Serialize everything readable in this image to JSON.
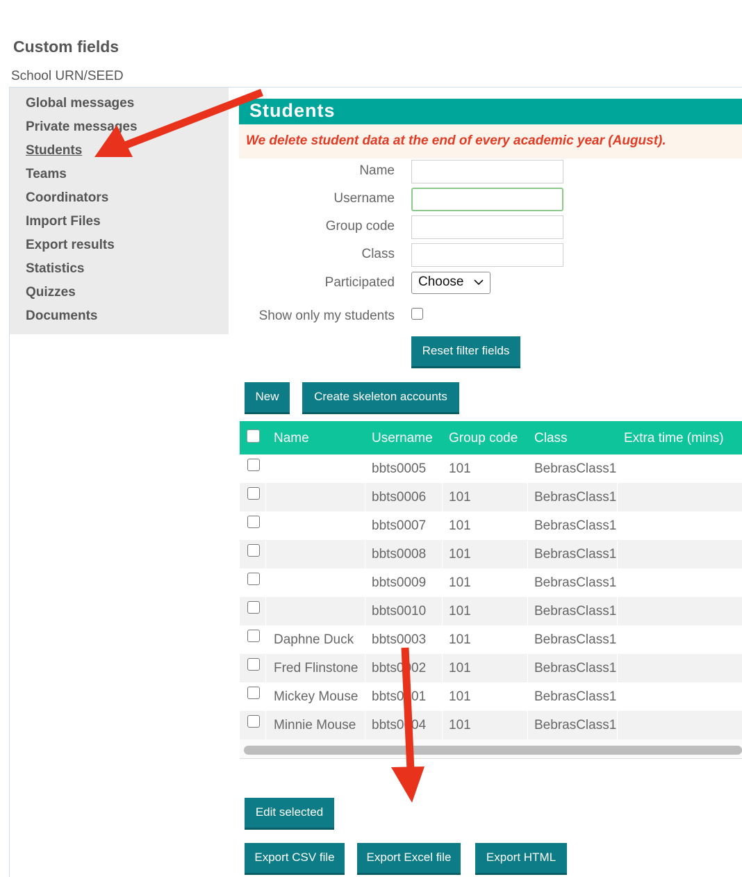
{
  "page": {
    "custom_fields_title": "Custom fields",
    "school_label": "School URN/SEED"
  },
  "sidebar": {
    "items": [
      {
        "label": "Global messages"
      },
      {
        "label": "Private messages"
      },
      {
        "label": "Students",
        "active": true
      },
      {
        "label": "Teams"
      },
      {
        "label": "Coordinators"
      },
      {
        "label": "Import Files"
      },
      {
        "label": "Export results"
      },
      {
        "label": "Statistics"
      },
      {
        "label": "Quizzes"
      },
      {
        "label": "Documents"
      }
    ]
  },
  "students": {
    "title": "Students",
    "notice": "We delete student data at the end of every academic year (August)."
  },
  "filters": {
    "name_label": "Name",
    "username_label": "Username",
    "group_code_label": "Group code",
    "class_label": "Class",
    "participated_label": "Participated",
    "participated_value": "Choose",
    "show_only_mine_label": "Show only my students",
    "name_value": "",
    "username_value": "",
    "group_code_value": "",
    "class_value": ""
  },
  "buttons": {
    "reset": "Reset filter fields",
    "new": "New",
    "skeleton": "Create skeleton accounts",
    "edit_selected": "Edit selected",
    "export_csv": "Export CSV file",
    "export_excel": "Export Excel file",
    "export_html": "Export HTML"
  },
  "table": {
    "headers": {
      "name": "Name",
      "username": "Username",
      "group_code": "Group code",
      "class": "Class",
      "extra_time": "Extra time (mins)"
    },
    "rows": [
      {
        "name": "",
        "username": "bbts0005",
        "group_code": "101",
        "class": "BebrasClass1"
      },
      {
        "name": "",
        "username": "bbts0006",
        "group_code": "101",
        "class": "BebrasClass1"
      },
      {
        "name": "",
        "username": "bbts0007",
        "group_code": "101",
        "class": "BebrasClass1"
      },
      {
        "name": "",
        "username": "bbts0008",
        "group_code": "101",
        "class": "BebrasClass1"
      },
      {
        "name": "",
        "username": "bbts0009",
        "group_code": "101",
        "class": "BebrasClass1"
      },
      {
        "name": "",
        "username": "bbts0010",
        "group_code": "101",
        "class": "BebrasClass1"
      },
      {
        "name": "Daphne Duck",
        "username": "bbts0003",
        "group_code": "101",
        "class": "BebrasClass1"
      },
      {
        "name": "Fred Flinstone",
        "username": "bbts0002",
        "group_code": "101",
        "class": "BebrasClass1"
      },
      {
        "name": "Mickey Mouse",
        "username": "bbts0001",
        "group_code": "101",
        "class": "BebrasClass1"
      },
      {
        "name": "Minnie Mouse",
        "username": "bbts0004",
        "group_code": "101",
        "class": "BebrasClass1"
      }
    ]
  },
  "colors": {
    "header_teal": "#00a699",
    "table_header_green": "#0ec49b",
    "button_teal": "#0e7c86",
    "notice_red": "#e53a23",
    "annotation_arrow": "#e8321c"
  }
}
